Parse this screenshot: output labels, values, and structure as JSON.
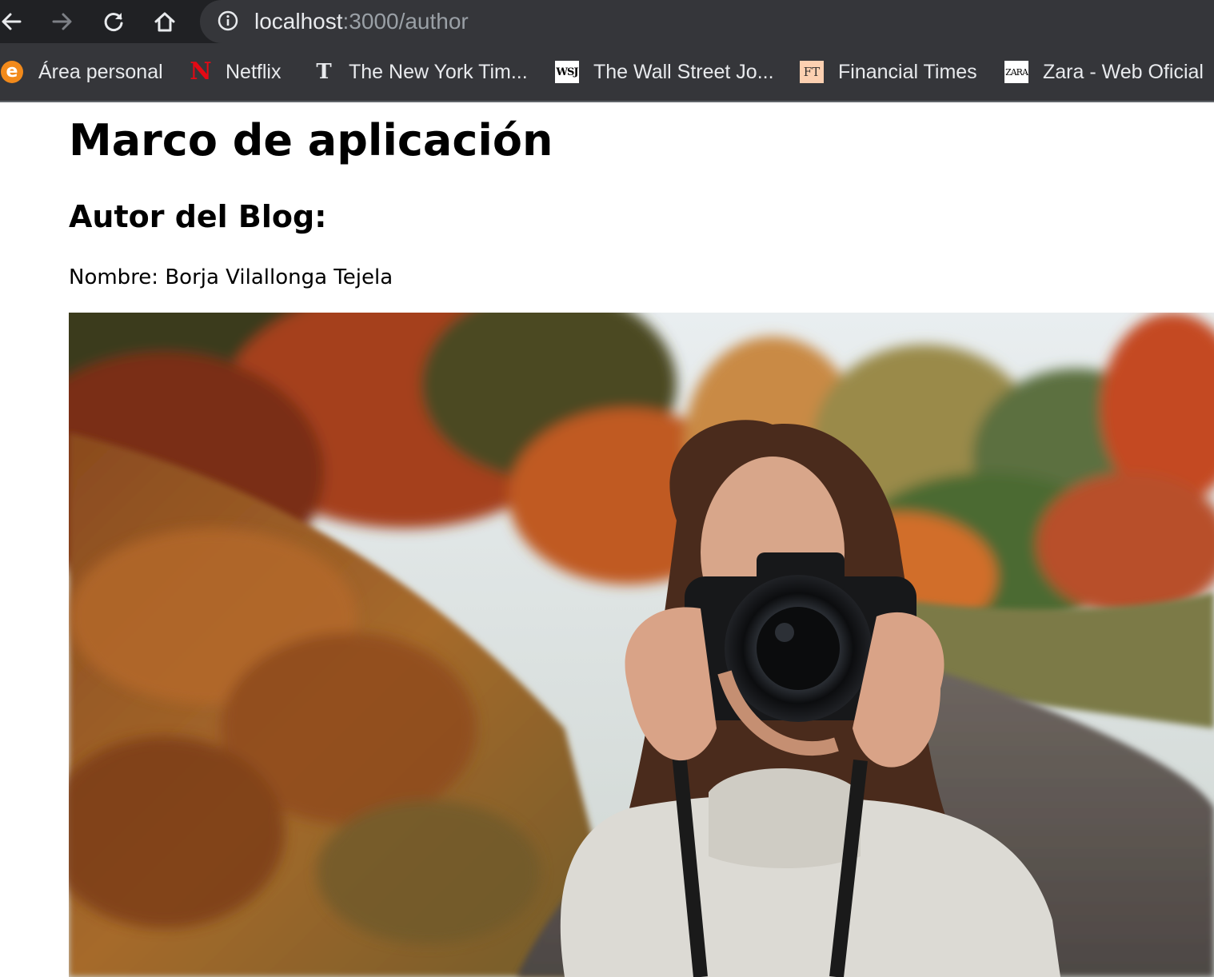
{
  "browser": {
    "url_host": "localhost",
    "url_path": ":3000/author",
    "bookmarks": [
      {
        "label": "Área personal",
        "icon": "e-orange-circle-icon"
      },
      {
        "label": "Netflix",
        "icon": "netflix-icon"
      },
      {
        "label": "The New York Tim...",
        "icon": "nyt-icon"
      },
      {
        "label": "The Wall Street Jo...",
        "icon": "wsj-icon"
      },
      {
        "label": "Financial Times",
        "icon": "ft-icon"
      },
      {
        "label": "Zara - Web Oficial",
        "icon": "zara-icon"
      }
    ],
    "favicon_text": {
      "e": "e",
      "netflix": "N",
      "nyt": "T",
      "wsj": "WSJ",
      "ft": "FT",
      "zara": "ZARA"
    },
    "colors": {
      "toolbar": "#202124",
      "omnibox": "#35363a",
      "text": "#e8eaed"
    }
  },
  "page": {
    "title": "Marco de aplicación",
    "section_title": "Autor del Blog:",
    "author_line": "Nombre: Borja Vilallonga Tejela",
    "photo_description_icon": "author-photo"
  }
}
